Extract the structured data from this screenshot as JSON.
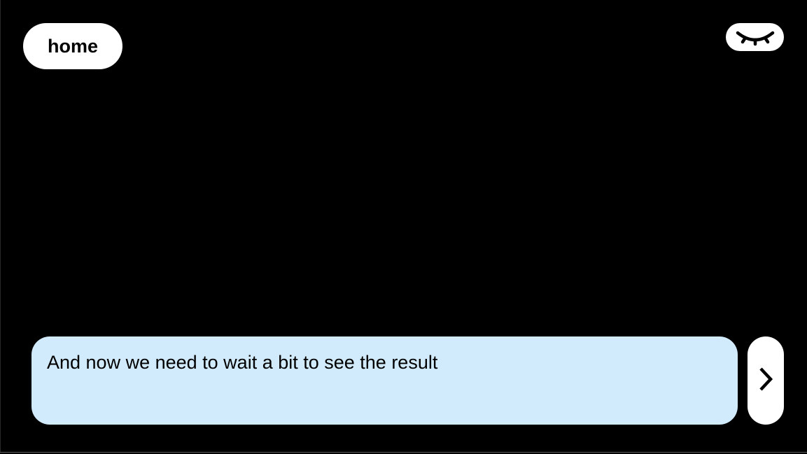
{
  "header": {
    "home_label": "home"
  },
  "eye_toggle": {
    "icon": "closed-eye-icon",
    "state": "hidden"
  },
  "composer": {
    "message_text": "And now we need to wait a bit to see the result",
    "send_icon": "chevron-right-icon"
  },
  "colors": {
    "background": "#000000",
    "button_bg": "#ffffff",
    "input_bg": "#d1ebfc",
    "text": "#000000"
  }
}
